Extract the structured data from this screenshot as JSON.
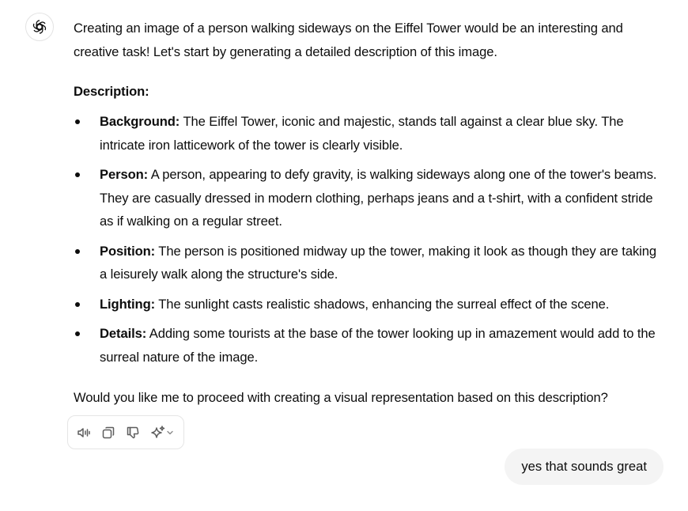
{
  "assistant": {
    "avatar_icon": "openai-logo-icon",
    "intro": "Creating an image of a person walking sideways on the Eiffel Tower would be an interesting and creative task! Let's start by generating a detailed description of this image.",
    "heading": "Description:",
    "items": [
      {
        "label": "Background:",
        "text": " The Eiffel Tower, iconic and majestic, stands tall against a clear blue sky. The intricate iron latticework of the tower is clearly visible."
      },
      {
        "label": "Person:",
        "text": " A person, appearing to defy gravity, is walking sideways along one of the tower's beams. They are casually dressed in modern clothing, perhaps jeans and a t-shirt, with a confident stride as if walking on a regular street."
      },
      {
        "label": "Position:",
        "text": " The person is positioned midway up the tower, making it look as though they are taking a leisurely walk along the structure's side."
      },
      {
        "label": "Lighting:",
        "text": " The sunlight casts realistic shadows, enhancing the surreal effect of the scene."
      },
      {
        "label": "Details:",
        "text": " Adding some tourists at the base of the tower looking up in amazement would add to the surreal nature of the image."
      }
    ],
    "closing": "Would you like me to proceed with creating a visual representation based on this description?"
  },
  "toolbar": {
    "icons": [
      "read-aloud-icon",
      "copy-icon",
      "thumbs-down-icon",
      "regenerate-sparkle-icon",
      "chevron-down-icon"
    ]
  },
  "user": {
    "message": "yes that sounds great"
  },
  "colors": {
    "text": "#0d0d0d",
    "icon": "#5d5d5d",
    "bubble": "#f4f4f4",
    "border": "#e5e5e5"
  }
}
